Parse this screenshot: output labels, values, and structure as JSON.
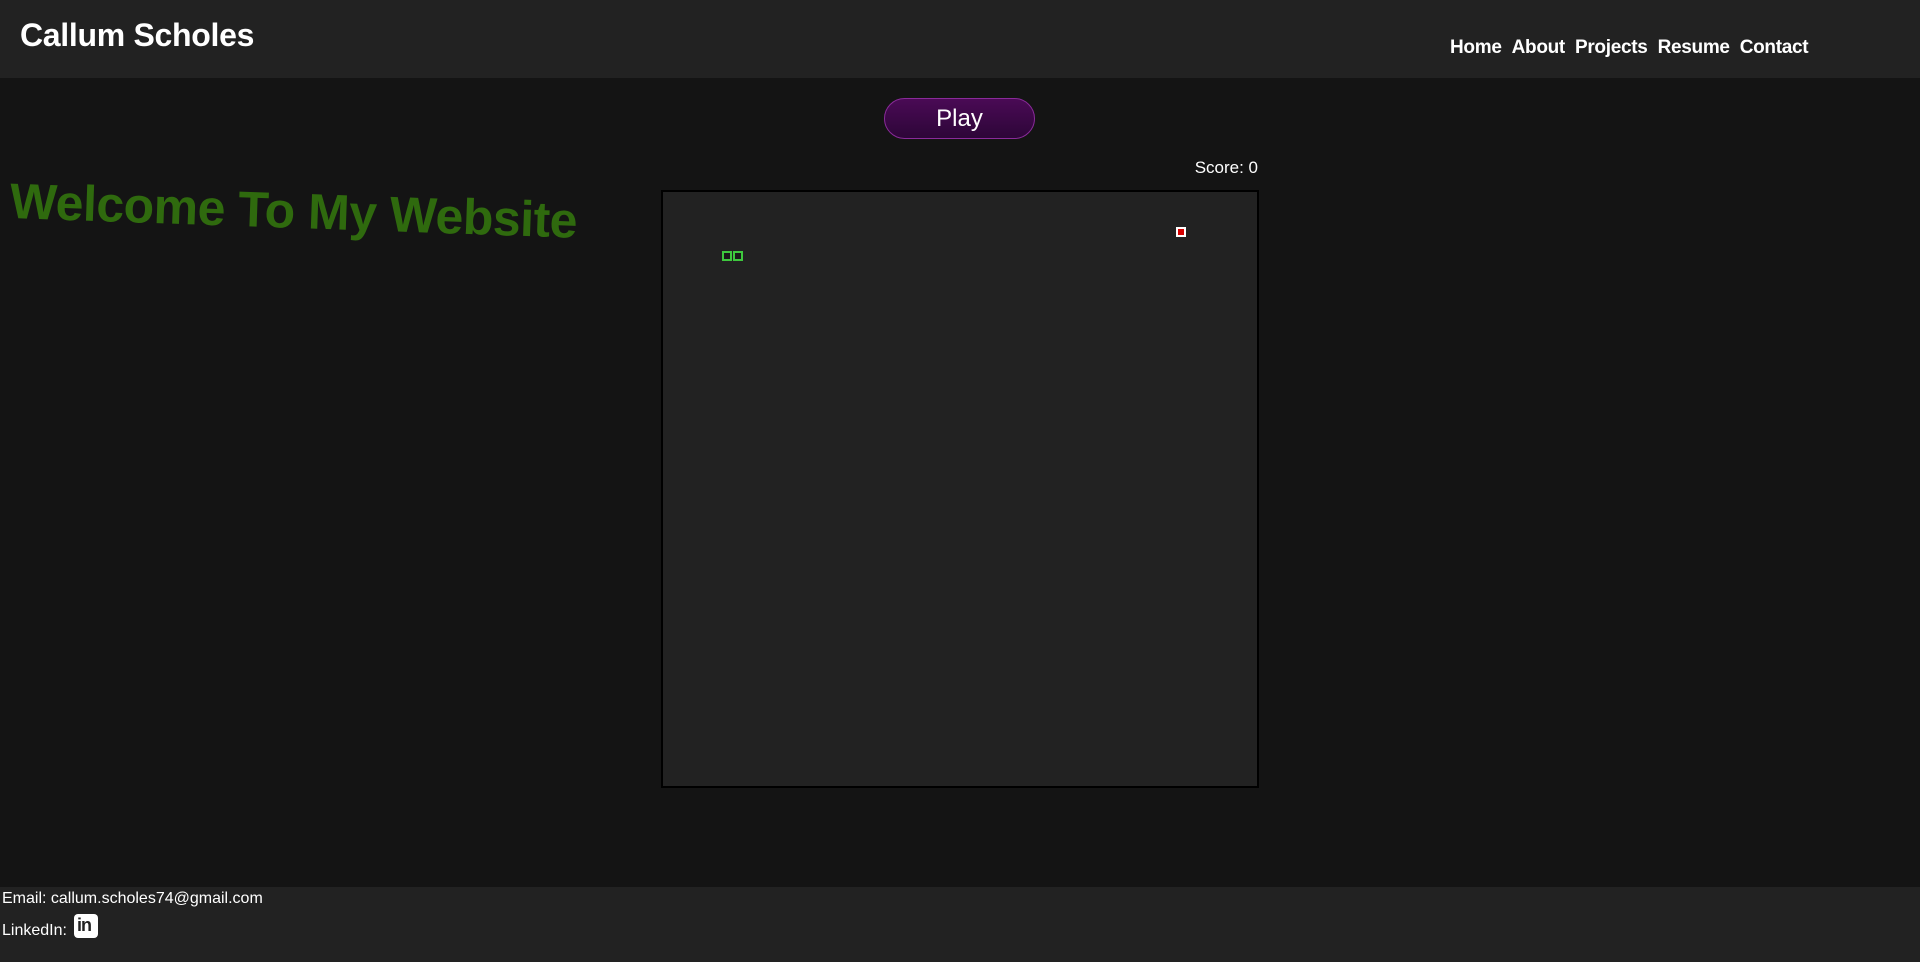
{
  "header": {
    "site_title": "Callum Scholes",
    "nav": [
      "Home",
      "About",
      "Projects",
      "Resume",
      "Contact"
    ]
  },
  "main": {
    "welcome_text": "Welcome To My Website",
    "play_label": "Play",
    "score_text": "Score: 0"
  },
  "footer": {
    "email_text": "Email: callum.scholes74@gmail.com",
    "linkedin_label": "LinkedIn:",
    "linkedin_icon": "linkedin-icon",
    "linkedin_icon_text": "in"
  },
  "colors": {
    "background": "#141414",
    "header_bg": "#222222",
    "welcome_green": "#2f6a0e",
    "play_purple": "#4a0a55",
    "snake_green": "#3ec83e",
    "food_red": "#d40000"
  }
}
